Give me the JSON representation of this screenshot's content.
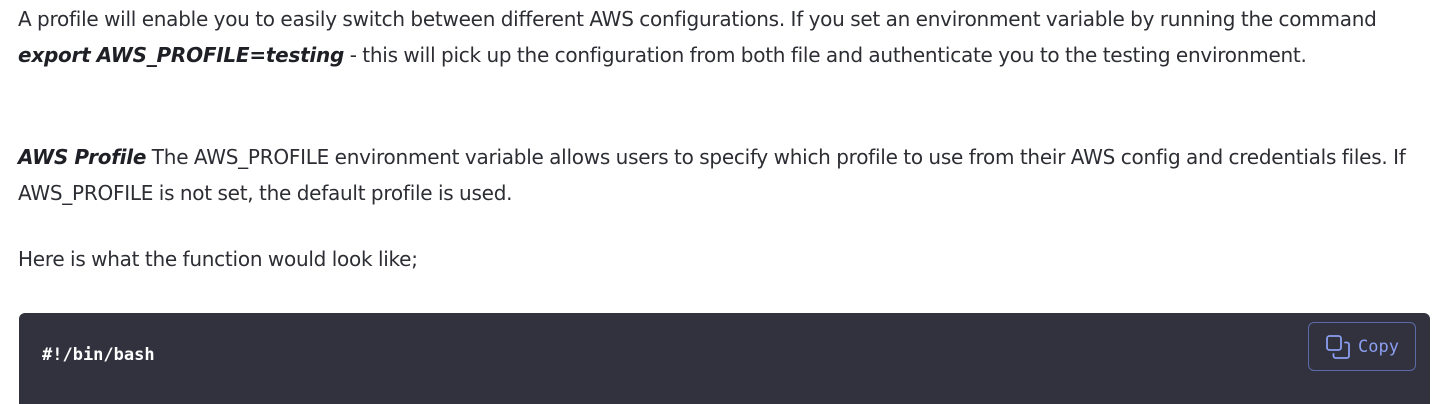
{
  "article": {
    "p1": {
      "before": "A profile will enable you to easily switch between different AWS configurations. If you set an environment variable by running the command ",
      "emphasis": "export AWS_PROFILE=testing",
      "after": " - this will pick up the configuration from both file and authenticate you to the testing environment."
    },
    "p2": {
      "emphasis": "AWS Profile",
      "text": " The AWS_PROFILE environment variable allows users to specify which profile to use from their AWS config and credentials files. If AWS_PROFILE is not set, the default profile is used."
    },
    "p3": {
      "text": "Here is what the function would look like;"
    }
  },
  "code_block": {
    "first_line": "#!/bin/bash",
    "copy_label": "Copy",
    "copy_icon": "copy-icon"
  },
  "colors": {
    "code_background": "#32323f",
    "copy_accent": "#8b9ef0",
    "copy_border": "#5c6aa8",
    "body_text": "#2c2e34"
  }
}
